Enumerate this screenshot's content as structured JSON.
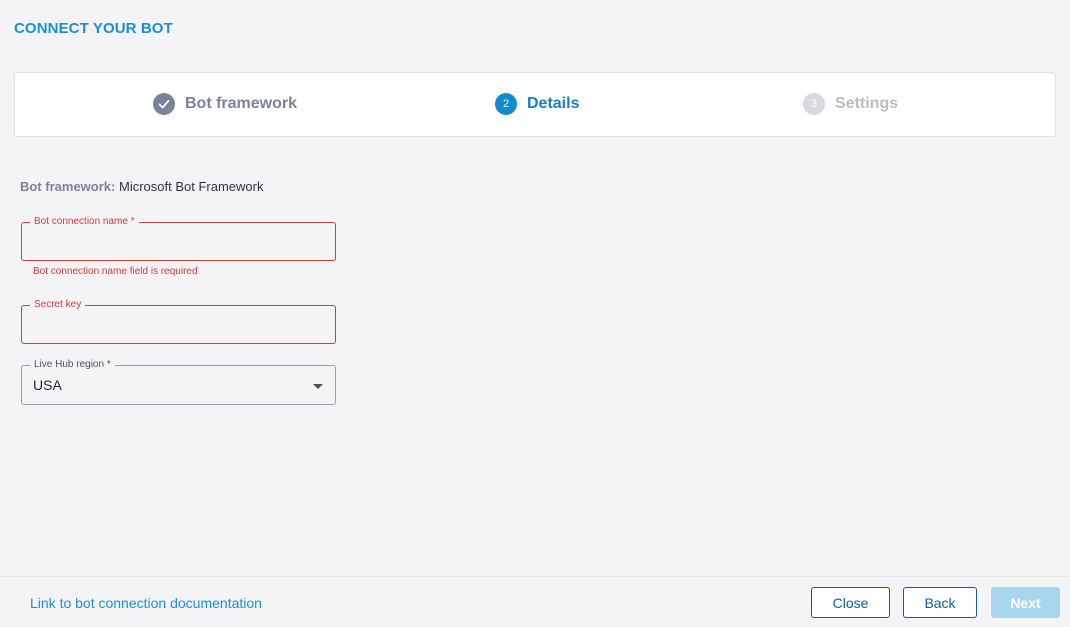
{
  "page": {
    "title": "CONNECT YOUR BOT"
  },
  "stepper": {
    "steps": [
      {
        "number": "",
        "label": "Bot framework",
        "state": "completed",
        "icon": "check-icon"
      },
      {
        "number": "2",
        "label": "Details",
        "state": "active"
      },
      {
        "number": "3",
        "label": "Settings",
        "state": "inactive"
      }
    ]
  },
  "details": {
    "framework_key": "Bot framework:",
    "framework_value": "Microsoft Bot Framework"
  },
  "form": {
    "connection_name": {
      "label": "Bot connection name *",
      "value": "",
      "error": "Bot connection name field is required"
    },
    "secret_key": {
      "label": "Secret key",
      "value": ""
    },
    "region": {
      "label": "Live Hub region *",
      "selected": "USA"
    }
  },
  "footer": {
    "doc_link": "Link to bot connection documentation",
    "close_label": "Close",
    "back_label": "Back",
    "next_label": "Next"
  },
  "colors": {
    "accent": "#1b8fd6",
    "error": "#d63b3b",
    "completed_step": "#7a8399",
    "next_disabled": "#a8d6ee"
  }
}
